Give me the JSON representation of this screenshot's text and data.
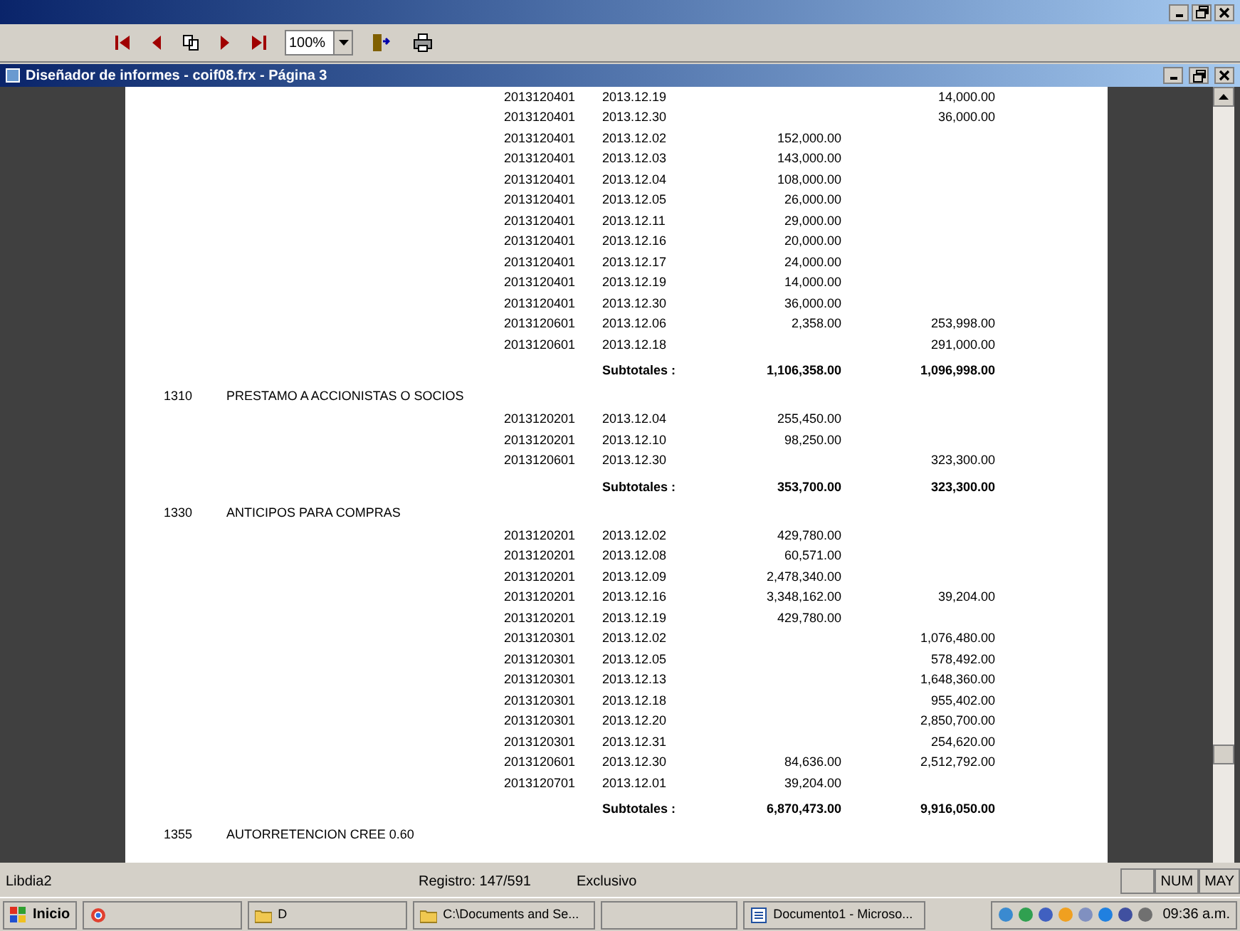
{
  "toolbar": {
    "zoom": "100%"
  },
  "document_window": {
    "title": "Diseñador de informes - coif08.frx - Página 3"
  },
  "report": {
    "sections": [
      {
        "rows": [
          {
            "account": "2013120401",
            "date": "2013.12.19",
            "debit": "",
            "credit": "14,000.00"
          },
          {
            "account": "2013120401",
            "date": "2013.12.30",
            "debit": "",
            "credit": "36,000.00"
          },
          {
            "account": "2013120401",
            "date": "2013.12.02",
            "debit": "152,000.00",
            "credit": ""
          },
          {
            "account": "2013120401",
            "date": "2013.12.03",
            "debit": "143,000.00",
            "credit": ""
          },
          {
            "account": "2013120401",
            "date": "2013.12.04",
            "debit": "108,000.00",
            "credit": ""
          },
          {
            "account": "2013120401",
            "date": "2013.12.05",
            "debit": "26,000.00",
            "credit": ""
          },
          {
            "account": "2013120401",
            "date": "2013.12.11",
            "debit": "29,000.00",
            "credit": ""
          },
          {
            "account": "2013120401",
            "date": "2013.12.16",
            "debit": "20,000.00",
            "credit": ""
          },
          {
            "account": "2013120401",
            "date": "2013.12.17",
            "debit": "24,000.00",
            "credit": ""
          },
          {
            "account": "2013120401",
            "date": "2013.12.19",
            "debit": "14,000.00",
            "credit": ""
          },
          {
            "account": "2013120401",
            "date": "2013.12.30",
            "debit": "36,000.00",
            "credit": ""
          },
          {
            "account": "2013120601",
            "date": "2013.12.06",
            "debit": "2,358.00",
            "credit": "253,998.00"
          },
          {
            "account": "2013120601",
            "date": "2013.12.18",
            "debit": "",
            "credit": "291,000.00"
          }
        ],
        "subtotal": {
          "label": "Subtotales :",
          "debit": "1,106,358.00",
          "credit": "1,096,998.00"
        }
      },
      {
        "code": "1310",
        "name": "PRESTAMO A ACCIONISTAS O SOCIOS",
        "rows": [
          {
            "account": "2013120201",
            "date": "2013.12.04",
            "debit": "255,450.00",
            "credit": ""
          },
          {
            "account": "2013120201",
            "date": "2013.12.10",
            "debit": "98,250.00",
            "credit": ""
          },
          {
            "account": "2013120601",
            "date": "2013.12.30",
            "debit": "",
            "credit": "323,300.00"
          }
        ],
        "subtotal": {
          "label": "Subtotales :",
          "debit": "353,700.00",
          "credit": "323,300.00"
        }
      },
      {
        "code": "1330",
        "name": "ANTICIPOS PARA COMPRAS",
        "rows": [
          {
            "account": "2013120201",
            "date": "2013.12.02",
            "debit": "429,780.00",
            "credit": ""
          },
          {
            "account": "2013120201",
            "date": "2013.12.08",
            "debit": "60,571.00",
            "credit": ""
          },
          {
            "account": "2013120201",
            "date": "2013.12.09",
            "debit": "2,478,340.00",
            "credit": ""
          },
          {
            "account": "2013120201",
            "date": "2013.12.16",
            "debit": "3,348,162.00",
            "credit": "39,204.00"
          },
          {
            "account": "2013120201",
            "date": "2013.12.19",
            "debit": "429,780.00",
            "credit": ""
          },
          {
            "account": "2013120301",
            "date": "2013.12.02",
            "debit": "",
            "credit": "1,076,480.00"
          },
          {
            "account": "2013120301",
            "date": "2013.12.05",
            "debit": "",
            "credit": "578,492.00"
          },
          {
            "account": "2013120301",
            "date": "2013.12.13",
            "debit": "",
            "credit": "1,648,360.00"
          },
          {
            "account": "2013120301",
            "date": "2013.12.18",
            "debit": "",
            "credit": "955,402.00"
          },
          {
            "account": "2013120301",
            "date": "2013.12.20",
            "debit": "",
            "credit": "2,850,700.00"
          },
          {
            "account": "2013120301",
            "date": "2013.12.31",
            "debit": "",
            "credit": "254,620.00"
          },
          {
            "account": "2013120601",
            "date": "2013.12.30",
            "debit": "84,636.00",
            "credit": "2,512,792.00"
          },
          {
            "account": "2013120701",
            "date": "2013.12.01",
            "debit": "39,204.00",
            "credit": ""
          }
        ],
        "subtotal": {
          "label": "Subtotales :",
          "debit": "6,870,473.00",
          "credit": "9,916,050.00"
        }
      },
      {
        "code": "1355",
        "name": "AUTORRETENCION CREE 0.60"
      }
    ]
  },
  "status_bar": {
    "user": "Libdia2",
    "record": "Registro: 147/591",
    "mode": "Exclusivo",
    "indicators": [
      "NUM",
      "MAY"
    ]
  },
  "taskbar": {
    "start": "Inicio",
    "buttons": [
      {
        "kind": "browser"
      },
      {
        "kind": "folder",
        "label": "D"
      },
      {
        "kind": "folder",
        "label": "C:\\Documents and Se..."
      },
      {
        "kind": "blank"
      },
      {
        "kind": "word",
        "label": "Documento1 - Microso..."
      }
    ],
    "clock": "09:36 a.m."
  }
}
